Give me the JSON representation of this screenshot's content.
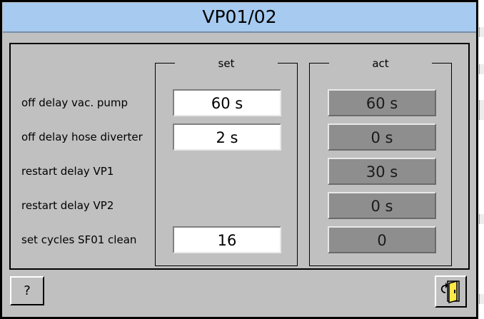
{
  "window": {
    "title": "VP01/02"
  },
  "groups": {
    "set_title": "set",
    "act_title": "act"
  },
  "rows": [
    {
      "label": "off delay vac. pump",
      "set": "60 s",
      "act": "60 s"
    },
    {
      "label": "off delay hose diverter",
      "set": "2 s",
      "act": "0 s"
    },
    {
      "label": "restart delay VP1",
      "set": "",
      "act": "30 s"
    },
    {
      "label": "restart delay VP2",
      "set": "",
      "act": "0 s"
    },
    {
      "label": "set cycles SF01 clean",
      "set": "16",
      "act": "0"
    }
  ],
  "buttons": {
    "help_label": "?"
  },
  "icons": {
    "exit": "exit-door-icon"
  }
}
